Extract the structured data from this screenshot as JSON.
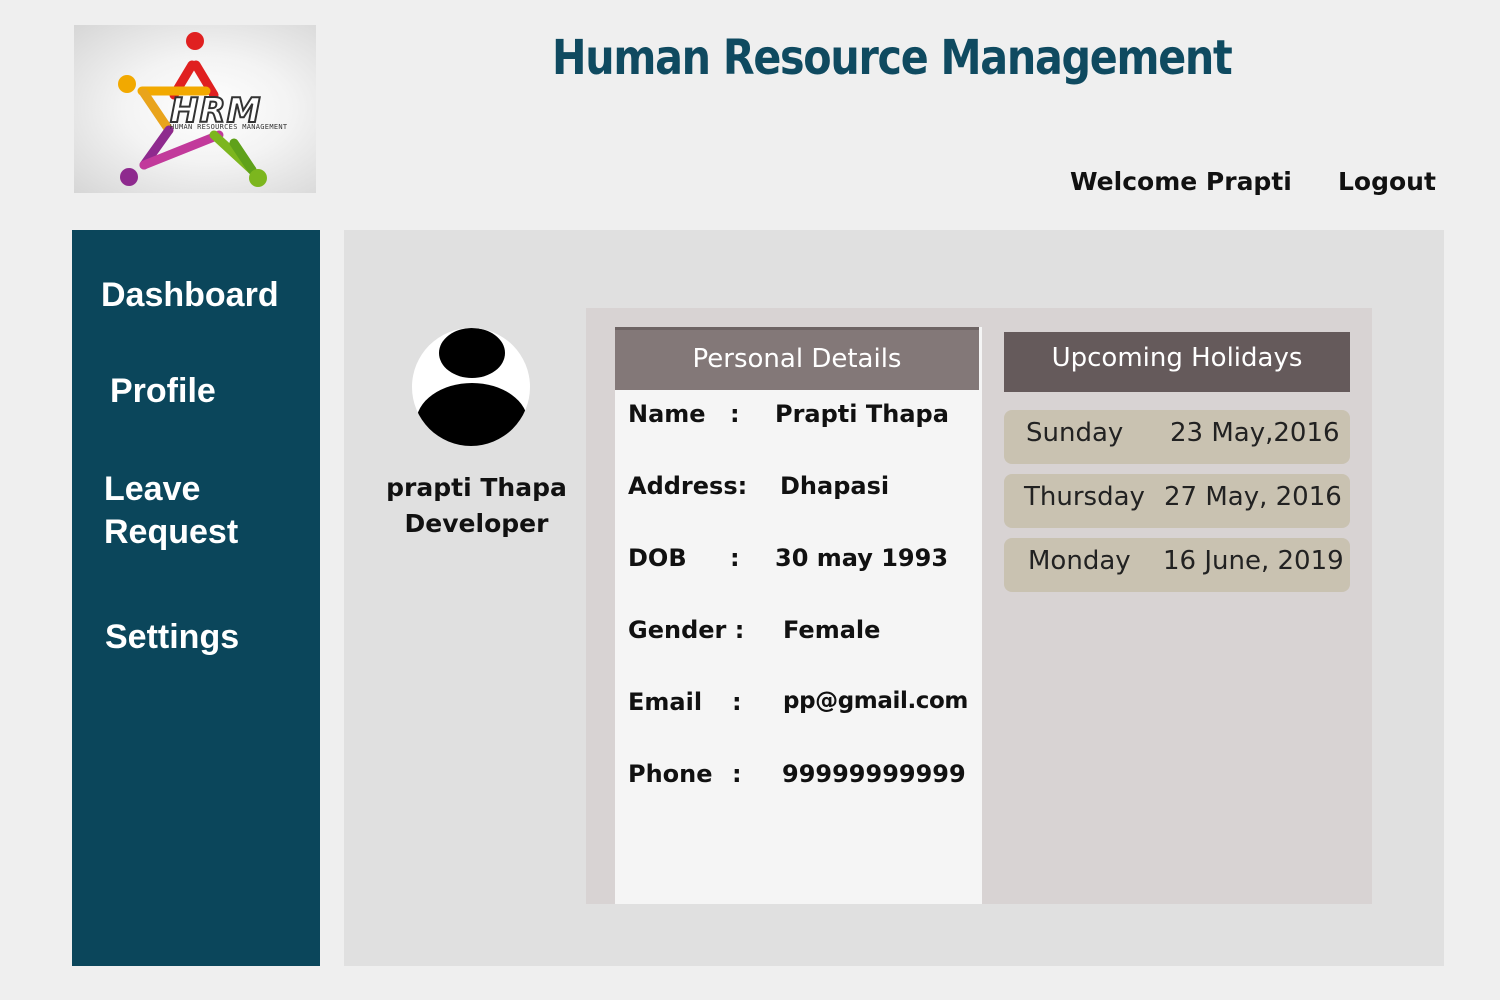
{
  "logo": {
    "text": "HRM",
    "subtext": "HUMAN RESOURCES MANAGEMENT",
    "colors": [
      "#e02020",
      "#f2a900",
      "#8e2a8e",
      "#7cb61e",
      "#c23a9b",
      "#e9a41c"
    ]
  },
  "header": {
    "title": "Human Resource Management",
    "welcome": "Welcome Prapti",
    "logout": "Logout"
  },
  "sidebar": {
    "items": [
      {
        "label": "Dashboard"
      },
      {
        "label": "Profile"
      },
      {
        "label": "Leave Request"
      },
      {
        "label": "Settings"
      }
    ]
  },
  "profile": {
    "avatar_icon": "user-avatar-icon",
    "name": "prapti Thapa",
    "role": "Developer"
  },
  "personal_details": {
    "title": "Personal Details",
    "fields": [
      {
        "label": "Name",
        "sep": ":",
        "value": "Prapti Thapa"
      },
      {
        "label": "Address:",
        "sep": "",
        "value": "Dhapasi"
      },
      {
        "label": "DOB",
        "sep": ":",
        "value": "30 may 1993"
      },
      {
        "label": "Gender :",
        "sep": "",
        "value": "Female"
      },
      {
        "label": "Email",
        "sep": ":",
        "value": "pp@gmail.com"
      },
      {
        "label": "Phone",
        "sep": ":",
        "value": "99999999999"
      }
    ]
  },
  "holidays": {
    "title": "Upcoming Holidays",
    "items": [
      {
        "day": "Sunday",
        "date": "23 May,2016"
      },
      {
        "day": "Thursday",
        "date": "27 May, 2016"
      },
      {
        "day": "Monday",
        "date": "16 June, 2019"
      }
    ]
  },
  "colors": {
    "sidebar": "#0b465b",
    "title": "#0f4a60",
    "details_header": "#837878",
    "holidays_header": "#655a5b",
    "holiday_row": "#c9c2b1"
  }
}
